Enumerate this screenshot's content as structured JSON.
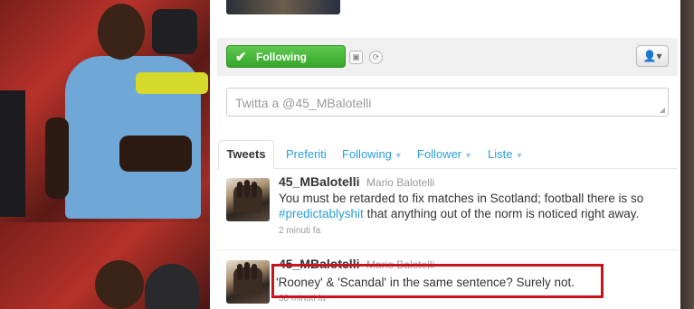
{
  "profile_actions": {
    "follow_button_label": "Following",
    "follow_check_icon": "check-icon",
    "user_menu_icon": "user-dropdown-icon"
  },
  "compose": {
    "placeholder": "Twitta a @45_MBalotelli"
  },
  "tabs": [
    {
      "label": "Tweets",
      "active": true
    },
    {
      "label": "Preferiti"
    },
    {
      "label": "Following"
    },
    {
      "label": "Follower"
    },
    {
      "label": "Liste"
    }
  ],
  "tweets": [
    {
      "screen_name": "45_MBalotelli",
      "full_name": "Mario Balotelli",
      "text_before": "You must be retarded to fix matches in Scotland; football there is so ",
      "hashtag": "#predictablyshit",
      "text_after": " that anything out of the norm is noticed right away.",
      "time": "2 minuti fa"
    },
    {
      "screen_name": "45_MBalotelli",
      "full_name": "Mario Balotelli",
      "text": "'Rooney' & 'Scandal' in the same sentence? Surely not.",
      "time": "30 minuti fa"
    }
  ],
  "colors": {
    "follow_green": "#35a62a",
    "link_blue": "#2a9fd8",
    "highlight_red": "#c8151b"
  }
}
